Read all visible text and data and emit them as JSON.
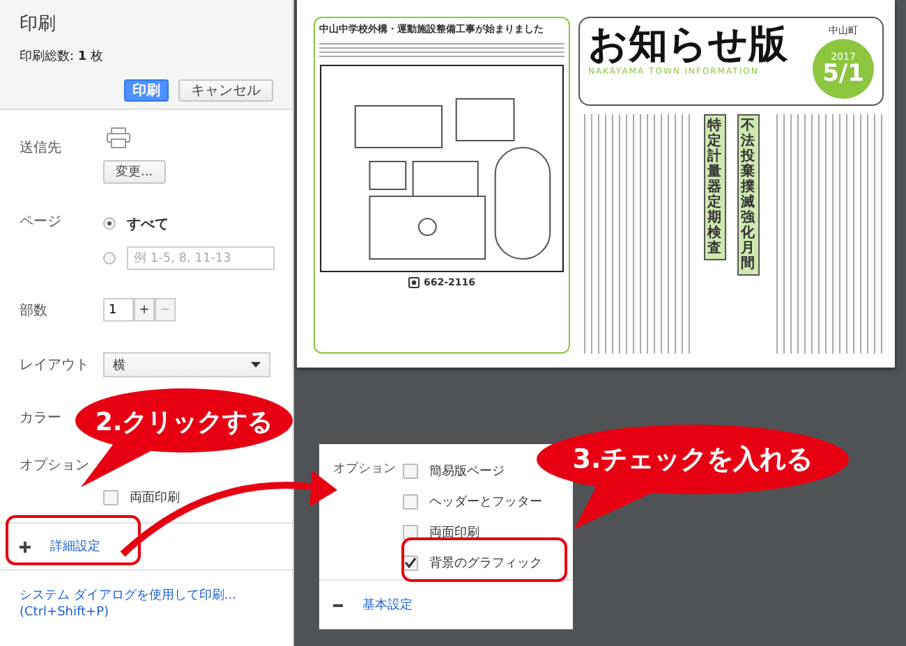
{
  "sidebar": {
    "title": "印刷",
    "total": "印刷総数: **1** 枚",
    "buttons": [
      {
        "label": "印刷",
        "kind": "primary"
      },
      {
        "label": "キャンセル",
        "kind": "secondary"
      }
    ],
    "destination": {
      "label": "送信先",
      "change_button": "変更..."
    },
    "pages": {
      "label": "ページ",
      "options": [
        {
          "kind": "all",
          "label": "すべて",
          "selected": true
        },
        {
          "kind": "range",
          "placeholder": "例 1-5, 8, 11-13",
          "selected": false
        }
      ]
    },
    "copies": {
      "label": "部数",
      "value": "1",
      "plus": "+",
      "minus": "−"
    },
    "layout": {
      "label": "レイアウト",
      "value": "横"
    },
    "color": {
      "label": "カラー"
    },
    "options": {
      "label": "オプション",
      "items": [
        {
          "label": "両面印刷",
          "checked": false
        }
      ]
    },
    "advanced": {
      "label": "詳細設定"
    },
    "system_dialog": {
      "link": "システム ダイアログを使用して印刷...",
      "shortcut": "(Ctrl+Shift+P)"
    }
  },
  "preview": {
    "article_title": "中山中学校外構・運動施設整備工事が始まりました",
    "phone": "662-2116",
    "masthead": "お知らせ版",
    "subtitle": "NAKAYAMA TOWN INFORMATION",
    "town": "中山町",
    "year": "2017",
    "date": "5/1",
    "vertical_headings": [
      "特定計量器定期検査",
      "不法投棄撲滅強化月間"
    ]
  },
  "inset": {
    "options_label": "オプション",
    "items": [
      {
        "label": "簡易版ページ",
        "checked": false
      },
      {
        "label": "ヘッダーとフッター",
        "checked": false
      },
      {
        "label": "両面印刷",
        "checked": false
      },
      {
        "label": "背景のグラフィック",
        "checked": true
      }
    ],
    "basic": {
      "label": "基本設定"
    }
  },
  "callouts": [
    {
      "text": "2.クリックする"
    },
    {
      "text": "3.チェックを入れる"
    }
  ]
}
